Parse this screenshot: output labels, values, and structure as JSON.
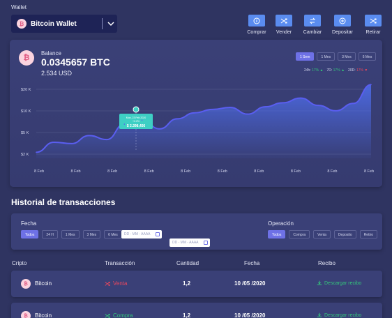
{
  "wallet": {
    "label": "Wallet",
    "selected": "Bitcoin Wallet",
    "coin_icon": "bitcoin-icon"
  },
  "actions": [
    {
      "label": "Comprar",
      "icon": "info-icon"
    },
    {
      "label": "Vender",
      "icon": "shuffle-icon"
    },
    {
      "label": "Cambiar",
      "icon": "swap-icon"
    },
    {
      "label": "Depositar",
      "icon": "plus-circle-icon"
    },
    {
      "label": "Retirar",
      "icon": "shuffle-icon"
    }
  ],
  "balance": {
    "label": "Balance",
    "btc": "0.0345657 BTC",
    "usd": "2.534 USD"
  },
  "ranges": [
    {
      "label": "1 Sem",
      "active": true
    },
    {
      "label": "1 Mes",
      "active": false
    },
    {
      "label": "3 Mes",
      "active": false
    },
    {
      "label": "6 Mes",
      "active": false
    }
  ],
  "stats": [
    {
      "label": "24h:",
      "value": "17%",
      "dir": "up"
    },
    {
      "label": "7D:",
      "value": "17%",
      "dir": "up"
    },
    {
      "label": "20D:",
      "value": "17%",
      "dir": "down"
    }
  ],
  "chart_data": {
    "type": "area",
    "x": [
      "8 Feb",
      "8 Feb",
      "8 Feb",
      "8 Feb",
      "8 Feb",
      "8 Feb",
      "8 Feb",
      "8 Feb",
      "8 Feb",
      "8 Feb"
    ],
    "y_ticks": [
      "$20 K",
      "$10 K",
      "$5 K",
      "$2 K"
    ],
    "values": [
      1.8,
      4.8,
      4.4,
      6.8,
      5.6,
      10.2,
      11.4,
      8.8,
      11.8,
      13.6,
      14.6,
      15.2,
      13.2,
      15.4,
      16.6,
      18.0,
      15.8,
      14.2,
      16.4,
      22.0
    ],
    "ylim": [
      0,
      22.5
    ],
    "tooltip": {
      "line1": "Mon, 23 Feb 2020",
      "line2": "+2.2%",
      "value": "$ 2.398,456"
    },
    "colors": {
      "line": "#5a5ef0",
      "area": "#4f6ff0",
      "grid": "#5b618f"
    }
  },
  "history": {
    "title": "Historial de transacciones",
    "fecha_label": "Fecha",
    "fecha_chips": [
      {
        "label": "Todos",
        "active": true
      },
      {
        "label": "24 H",
        "active": false
      },
      {
        "label": "1 Mes",
        "active": false
      },
      {
        "label": "3 Mes",
        "active": false
      },
      {
        "label": "6 Mes",
        "active": false
      }
    ],
    "date_placeholder": "DD - MM - AAAA",
    "operacion_label": "Operación",
    "operacion_chips": [
      {
        "label": "Todos",
        "active": true
      },
      {
        "label": "Compra",
        "active": false
      },
      {
        "label": "Venta",
        "active": false
      },
      {
        "label": "Deposito",
        "active": false
      },
      {
        "label": "Retiro",
        "active": false
      }
    ],
    "columns": [
      "Cripto",
      "Transacción",
      "Cantidad",
      "Fecha",
      "Recibo"
    ],
    "rows": [
      {
        "coin": "Bitcoin",
        "type": "Venta",
        "type_color": "#e8475e",
        "qty": "1,2",
        "date": "10 /05 /2020",
        "receipt": "Descargar recibo"
      },
      {
        "coin": "Bitcoin",
        "type": "Compra",
        "type_color": "#34c77b",
        "qty": "1,2",
        "date": "10 /05 /2020",
        "receipt": "Descargar recibo"
      }
    ]
  }
}
